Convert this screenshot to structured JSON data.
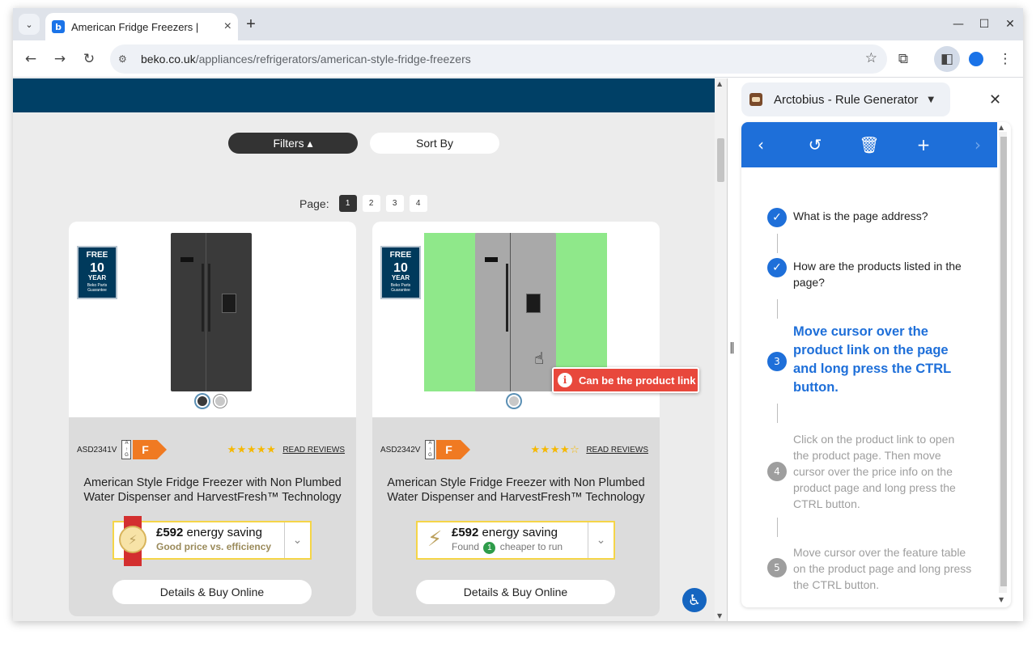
{
  "browser": {
    "tab_title": "American Fridge Freezers |",
    "tab_favicon_letter": "b",
    "url_domain": "beko.co.uk",
    "url_path": "/appliances/refrigerators/american-style-fridge-freezers"
  },
  "page": {
    "filters_label": "Filters ▴",
    "sort_label": "Sort By",
    "pager_label": "Page:",
    "pages": [
      "1",
      "2",
      "3",
      "4"
    ],
    "active_page": "1"
  },
  "badge": {
    "line1": "FREE",
    "line2": "10",
    "line3": "YEAR",
    "line4": "Beko Parts Guarantee"
  },
  "energy_scale": [
    "A",
    "↑",
    "G"
  ],
  "products": [
    {
      "model": "ASD2341V",
      "energy_class": "F",
      "rating": 5,
      "stars": "★★★★★",
      "reviews_label": "READ REVIEWS",
      "title": "American Style Fridge Freezer with Non Plumbed Water Dispenser and HarvestFresh™ Technology",
      "saving_amount": "£592",
      "saving_text": "energy saving",
      "saving_sub": "Good price vs. efficiency",
      "details_label": "Details & Buy Online",
      "color": "#3a3a3a"
    },
    {
      "model": "ASD2342V",
      "energy_class": "F",
      "rating": 4.5,
      "stars": "★★★★☆",
      "reviews_label": "READ REVIEWS",
      "title": "American Style Fridge Freezer with Non Plumbed Water Dispenser and HarvestFresh™ Technology",
      "saving_amount": "£592",
      "saving_text": "energy saving",
      "saving_found": "Found",
      "saving_count": "1",
      "saving_sub2": "cheaper to run",
      "details_label": "Details & Buy Online",
      "color": "#a9a9a9"
    }
  ],
  "overlay": {
    "tooltip": "Can be the product link",
    "highlight_color": "#8fe88a"
  },
  "side_panel": {
    "title": "Arctobius - Rule Generator",
    "steps": [
      {
        "n": "✓",
        "state": "done",
        "text": "What is the page address?"
      },
      {
        "n": "✓",
        "state": "done",
        "text": "How are the products listed in the page?"
      },
      {
        "n": "3",
        "state": "active",
        "text": "Move cursor over the product link on the page and long press the CTRL button."
      },
      {
        "n": "4",
        "state": "pending",
        "text": "Click on the product link to open the product page. Then move cursor over the price info on the product page and long press the CTRL button."
      },
      {
        "n": "5",
        "state": "pending",
        "text": "Move cursor over the feature table on the product page and long press the CTRL button."
      }
    ]
  },
  "colors": {
    "header_band": "#004066",
    "accent_blue": "#1e6fd9",
    "energy_orange": "#f07a22",
    "tooltip_red": "#e8483c"
  }
}
